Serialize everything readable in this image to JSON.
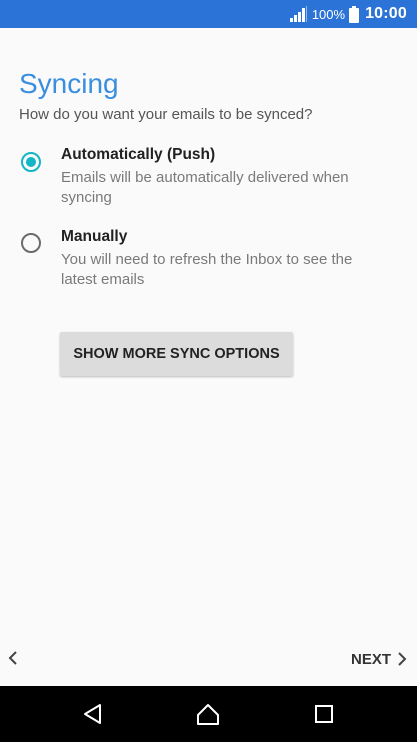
{
  "status_bar": {
    "battery_percent": "100%",
    "time": "10:00",
    "icons": [
      "signal-icon",
      "battery-icon"
    ],
    "color": "#2b73d6"
  },
  "screen": {
    "title": "Syncing",
    "subtitle": "How do you want your emails to be synced?"
  },
  "sync_options": [
    {
      "label": "Automatically (Push)",
      "description": "Emails will be automatically delivered when syncing",
      "selected": true
    },
    {
      "label": "Manually",
      "description": "You will need to refresh the Inbox to see the latest emails",
      "selected": false
    }
  ],
  "more_button": {
    "label": "SHOW MORE SYNC OPTIONS"
  },
  "wizard_nav": {
    "back_icon": "chevron-left-icon",
    "next_label": "NEXT",
    "next_icon": "chevron-right-icon"
  },
  "system_nav": {
    "icons": [
      "back-triangle-icon",
      "home-icon",
      "recent-apps-icon"
    ]
  },
  "colors": {
    "accent": "#3a8ee0",
    "radio_selected": "#12b6c4"
  }
}
